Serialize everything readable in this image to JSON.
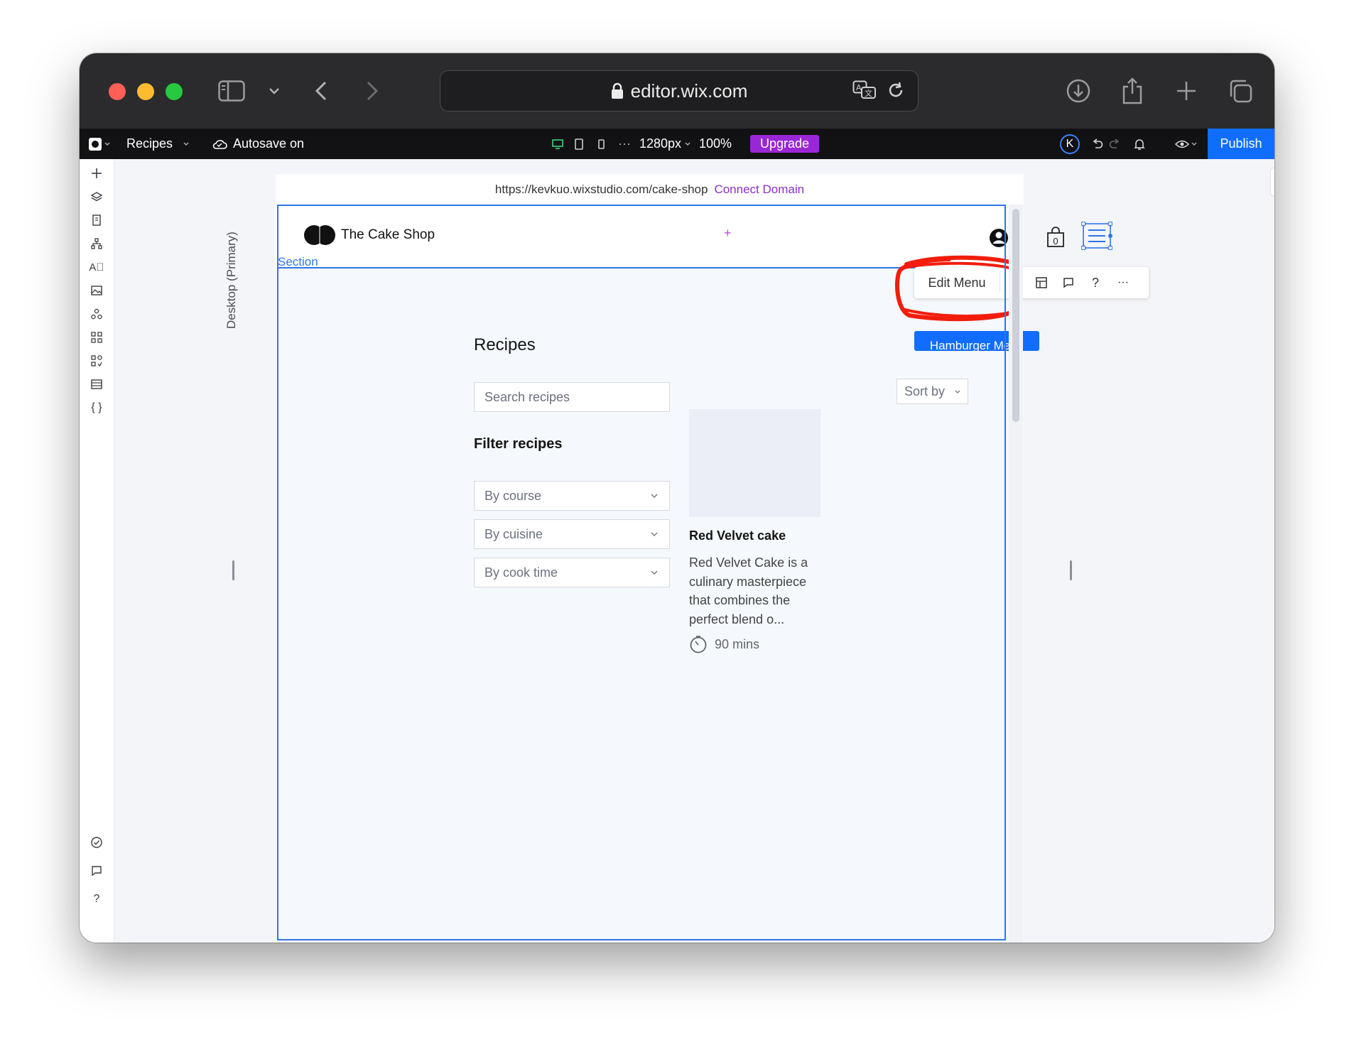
{
  "browser": {
    "url": "editor.wix.com"
  },
  "editor": {
    "site_name": "Recipes",
    "autosave": "Autosave on",
    "width_display": "1280px",
    "zoom": "100%",
    "upgrade_label": "Upgrade",
    "account_initial": "K",
    "publish_label": "Publish",
    "viewport_label": "Desktop (Primary)"
  },
  "site": {
    "url": "https://kevkuo.wixstudio.com/cake-shop",
    "connect_domain": "Connect Domain",
    "brand_name": "The Cake Shop",
    "cart_count": "0",
    "section_label": "Section"
  },
  "context_toolbar": {
    "edit_menu": "Edit Menu",
    "help": "?",
    "more": "···",
    "selection_tag": "Hamburger Menu"
  },
  "recipes": {
    "title": "Recipes",
    "search_placeholder": "Search recipes",
    "filter_title": "Filter recipes",
    "filters": [
      "By course",
      "By cuisine",
      "By cook time"
    ],
    "sort_label": "Sort by",
    "card": {
      "name": "Red Velvet cake",
      "description_lines": [
        "Red Velvet Cake is a",
        "culinary masterpiece",
        "that combines the",
        "perfect blend o..."
      ],
      "time": "90 mins"
    }
  },
  "colors": {
    "publish_bg": "#116dff",
    "upgrade_bg": "#9a27d5",
    "selection": "#2f76e8",
    "annotation": "#f21d0c",
    "connect_domain": "#8b2fc9"
  }
}
